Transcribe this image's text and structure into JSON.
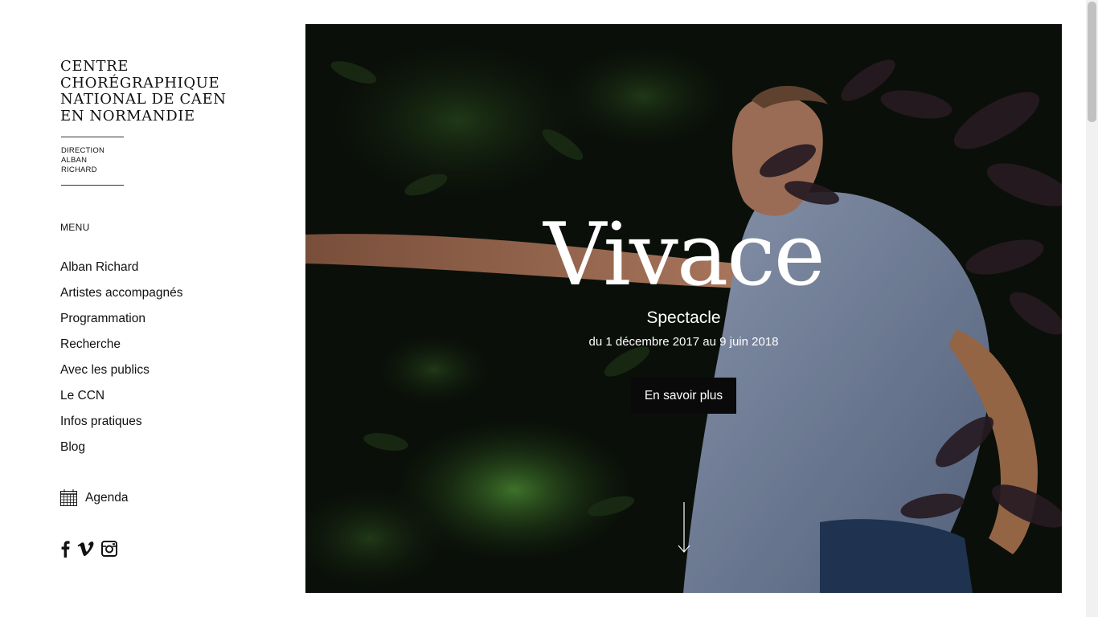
{
  "logo": {
    "lines": [
      "CENTRE",
      "CHORÉGRAPHIQUE",
      "NATIONAL DE CAEN",
      "EN NORMANDIE"
    ]
  },
  "direction": {
    "line1": "DIRECTION",
    "line2": "ALBAN RICHARD"
  },
  "menu": {
    "heading": "MENU",
    "items": [
      "Alban Richard",
      "Artistes accompagnés",
      "Programmation",
      "Recherche",
      "Avec les publics",
      "Le CCN",
      "Infos pratiques",
      "Blog"
    ]
  },
  "agenda": {
    "label": "Agenda",
    "icon": "calendar-icon"
  },
  "social": {
    "icons": [
      "facebook-icon",
      "vimeo-icon",
      "instagram-icon"
    ]
  },
  "hero": {
    "title": "Vivace",
    "subtitle": "Spectacle",
    "dates": "du 1 décembre 2017 au 9 juin 2018",
    "button_label": "En savoir plus",
    "scroll_icon": "arrow-down-icon"
  },
  "colors": {
    "text": "#111111",
    "hero_overlay_text": "#ffffff",
    "button_bg": "#0a0a0a",
    "foliage_dark": "#0c120b",
    "foliage_green": "#3f7a2a",
    "shirt_blue": "#7f8fab"
  }
}
